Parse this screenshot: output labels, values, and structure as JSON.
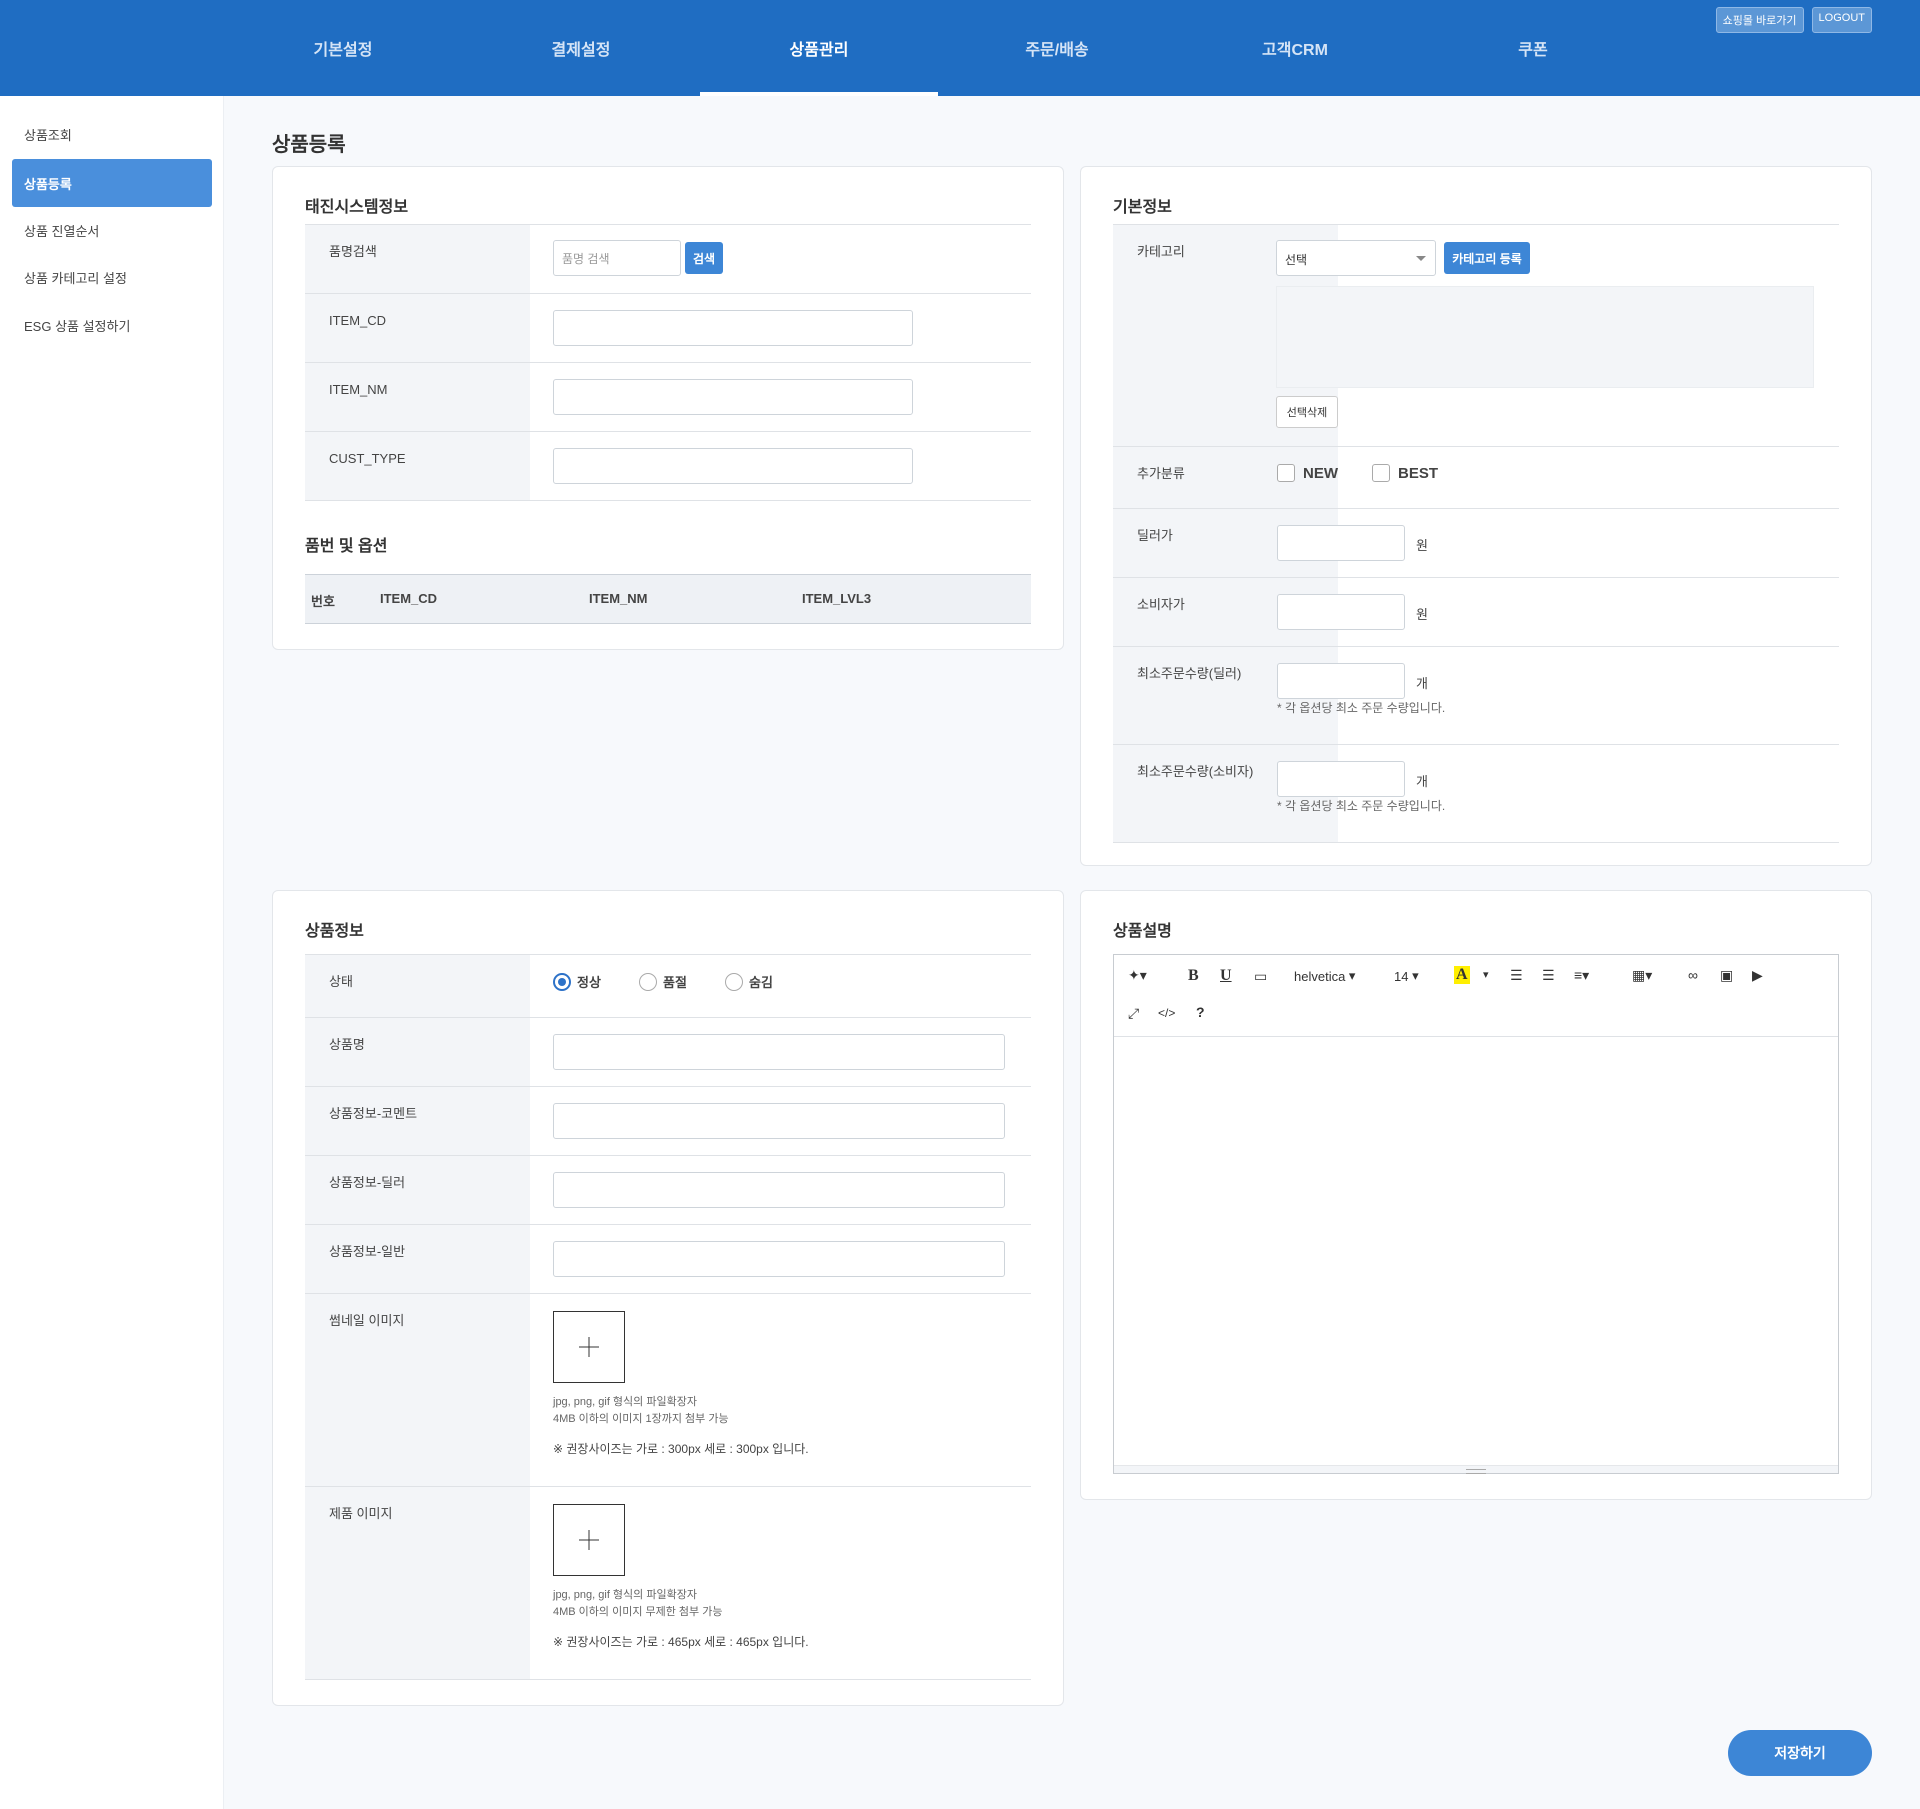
{
  "header": {
    "top_links": [
      "쇼핑몰 바로가기",
      "LOGOUT"
    ],
    "nav": [
      "기본설정",
      "결제설정",
      "상품관리",
      "주문/배송",
      "고객CRM",
      "쿠폰"
    ],
    "active_nav": "상품관리"
  },
  "sidebar": {
    "items": [
      {
        "label": "상품조회"
      },
      {
        "label": "상품등록"
      },
      {
        "label": "상품 진열순서"
      },
      {
        "label": "상품 카테고리 설정"
      },
      {
        "label": "ESG 상품 설정하기"
      }
    ],
    "active": "상품등록"
  },
  "page_title": "상품등록",
  "system_panel": {
    "title": "태진시스템정보",
    "rows": [
      {
        "label": "품명검색",
        "placeholder": "품명 검색",
        "button": "검색"
      },
      {
        "label": "ITEM_CD"
      },
      {
        "label": "ITEM_NM"
      },
      {
        "label": "CUST_TYPE"
      }
    ],
    "options_title": "품번 및 옵션",
    "columns": [
      "번호",
      "ITEM_CD",
      "ITEM_NM",
      "ITEM_LVL3"
    ]
  },
  "basic_panel": {
    "title": "기본정보",
    "category_label": "카테고리",
    "category_select": "선택",
    "category_register_button": "카테고리 등록",
    "delete_selected_button": "선택삭제",
    "extra_label": "추가분류",
    "extra_options": [
      "NEW",
      "BEST"
    ],
    "dealer_price_label": "딜러가",
    "consumer_price_label": "소비자가",
    "currency_unit": "원",
    "min_qty_dealer_label": "최소주문수량(딜러)",
    "min_qty_consumer_label": "최소주문수량(소비자)",
    "qty_unit": "개",
    "qty_hint": "* 각 옵션당 최소 주문 수량입니다."
  },
  "product_panel": {
    "title": "상품정보",
    "status_label": "상태",
    "status_options": [
      "정상",
      "품절",
      "숨김"
    ],
    "status_selected": "정상",
    "fields": [
      "상품명",
      "상품정보-코멘트",
      "상품정보-딜러",
      "상품정보-일반"
    ],
    "thumbnail_label": "썸네일 이미지",
    "thumbnail_hint1": "jpg, png, gif 형식의 파일확장자",
    "thumbnail_hint2": "4MB 이하의 이미지 1장까지 첨부 가능",
    "thumbnail_size": "※ 권장사이즈는 가로 : 300px 세로 : 300px 입니다.",
    "product_image_label": "제품 이미지",
    "product_hint1": "jpg, png, gif 형식의 파일확장자",
    "product_hint2": "4MB 이하의 이미지 무제한 첨부 가능",
    "product_size": "※ 권장사이즈는 가로 : 465px 세로 : 465px 입니다."
  },
  "description_panel": {
    "title": "상품설명",
    "font_name": "helvetica",
    "font_size": "14"
  },
  "save_button": "저장하기",
  "colors": {
    "primary": "#1f6dc2",
    "accent": "#3d86d6",
    "active_side": "#4a8fdc"
  }
}
